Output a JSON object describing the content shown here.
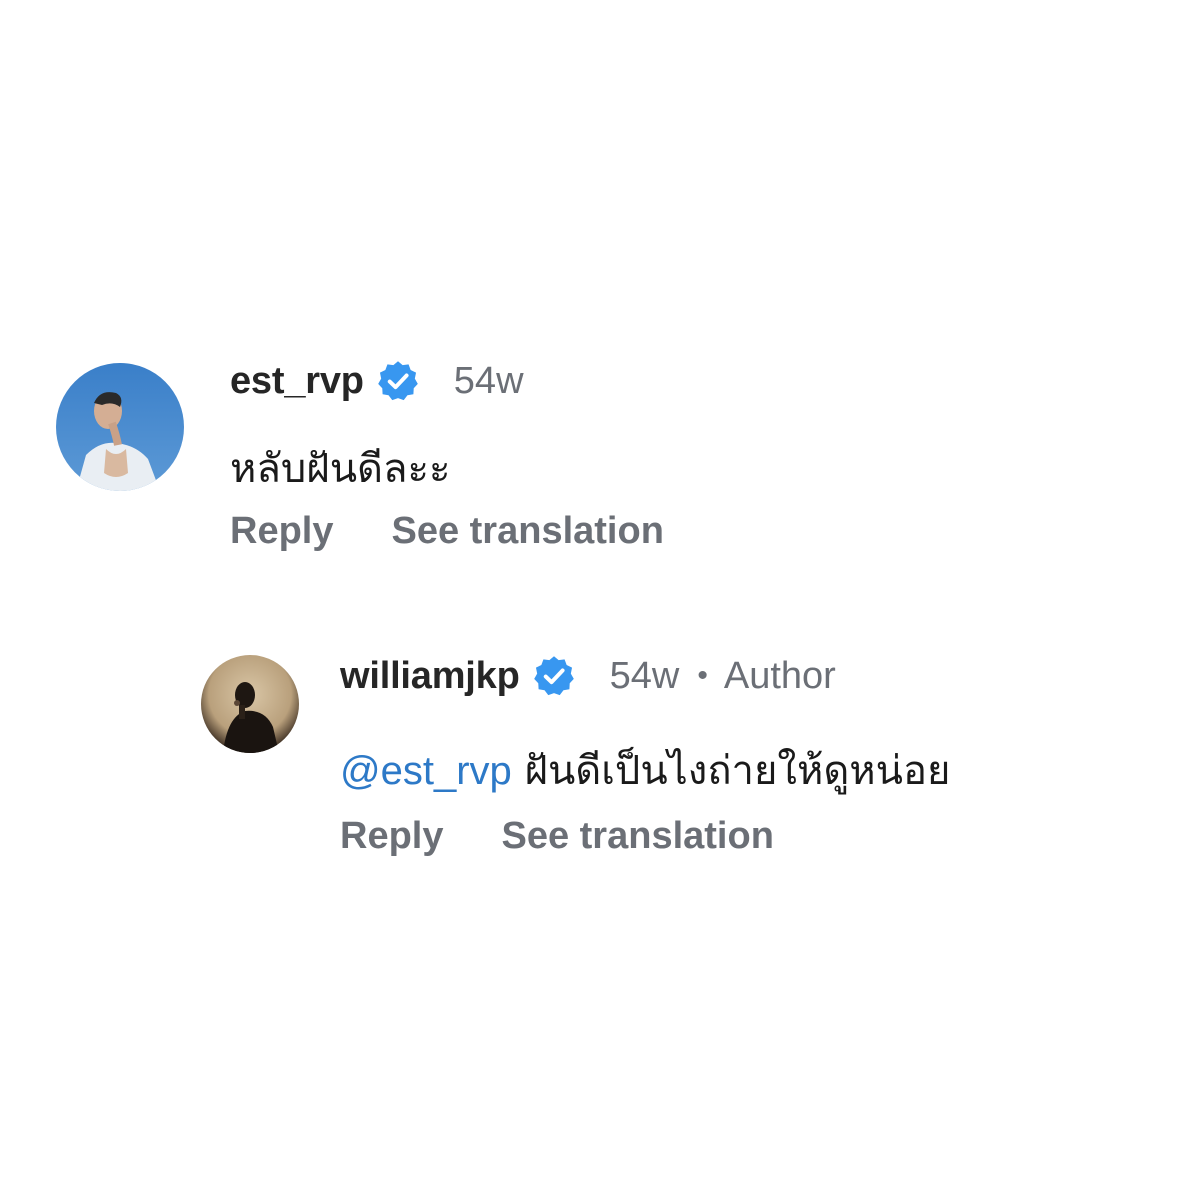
{
  "comments": [
    {
      "username": "est_rvp",
      "verified": true,
      "verified_icon": "verified-badge-icon",
      "time": "54w",
      "text": "หลับฝันดีละะ",
      "actions": {
        "reply": "Reply",
        "see_translation": "See translation"
      },
      "avatar_icon": "profile-photo-sky"
    },
    {
      "username": "williamjkp",
      "verified": true,
      "verified_icon": "verified-badge-icon",
      "time": "54w",
      "separator": "•",
      "author_tag": "Author",
      "mention": "@est_rvp",
      "text": "ฝันดีเป็นไงถ่ายให้ดูหน่อย",
      "actions": {
        "reply": "Reply",
        "see_translation": "See translation"
      },
      "avatar_icon": "profile-photo-dark"
    }
  ],
  "colors": {
    "verified_blue": "#3897f0",
    "mention_blue": "#2d79c7",
    "secondary_text": "#6b6f76",
    "primary_text": "#262626"
  }
}
